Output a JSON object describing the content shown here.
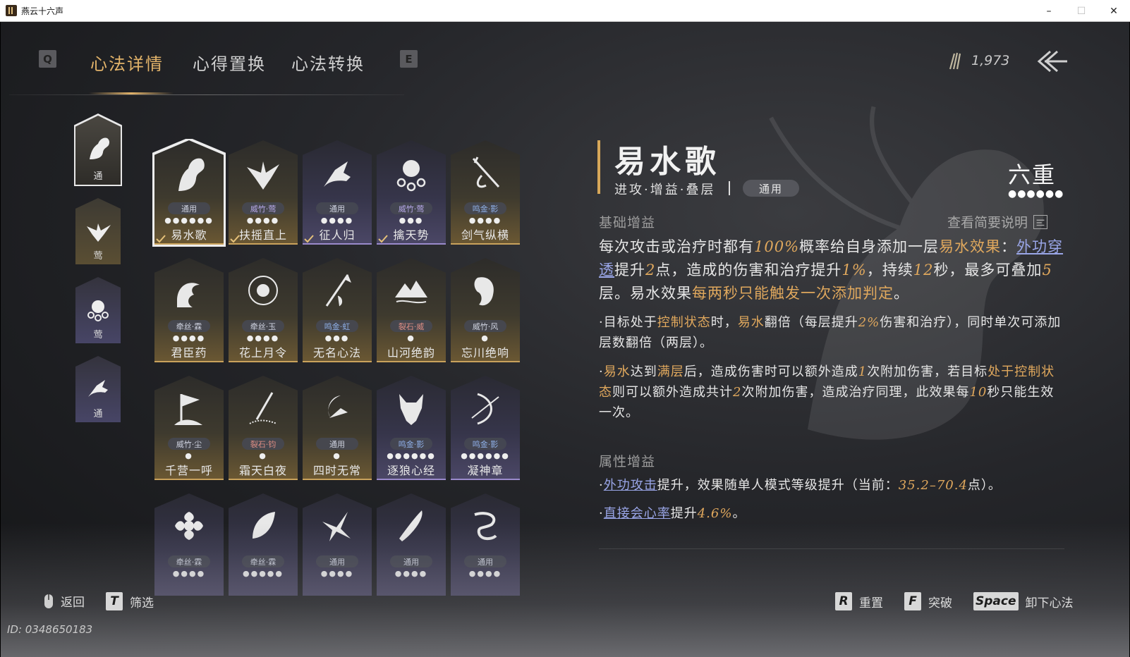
{
  "window": {
    "title": "燕云十六声",
    "min": "–",
    "max": "☐",
    "close": "✕"
  },
  "nav": {
    "key_left": "Q",
    "key_right": "E",
    "tabs": [
      "心法详情",
      "心得置换",
      "心法转换"
    ],
    "active_tab": 0
  },
  "currency": {
    "icon": "feather-icon",
    "amount": "1,973"
  },
  "categories": [
    {
      "label": "通",
      "icon": "horse-icon"
    },
    {
      "label": "莺",
      "icon": "eagle-icon"
    },
    {
      "label": "莺",
      "icon": "chain-fist-icon"
    },
    {
      "label": "通",
      "icon": "bird-hand-icon"
    }
  ],
  "cards": [
    {
      "name": "易水歌",
      "tag": "通用",
      "tag_color": "plain",
      "dots": "●●●●●●",
      "style": "gold",
      "selected": true,
      "check": true,
      "icon": "horse-icon"
    },
    {
      "name": "扶摇直上",
      "tag": "威竹·莺",
      "tag_color": "purple",
      "dots": "●●●●",
      "style": "gold",
      "check": true,
      "icon": "eagle-icon"
    },
    {
      "name": "征人归",
      "tag": "通用",
      "tag_color": "plain",
      "dots": "●●●●",
      "style": "purple",
      "check": true,
      "icon": "bird-hand-icon"
    },
    {
      "name": "擒天势",
      "tag": "威竹·莺",
      "tag_color": "purple",
      "dots": "●●●",
      "style": "purple",
      "check": true,
      "icon": "chain-fist-icon"
    },
    {
      "name": "剑气纵横",
      "tag": "鸣金·影",
      "tag_color": "blue",
      "dots": "●●●●",
      "style": "gold",
      "icon": "sword-icon"
    },
    {
      "name": "君臣药",
      "tag": "牵丝·霖",
      "tag_color": "plain",
      "dots": "●●●●",
      "style": "gold",
      "icon": "wave-icon"
    },
    {
      "name": "花上月令",
      "tag": "牵丝·玉",
      "tag_color": "plain",
      "dots": "●●●●",
      "style": "gold",
      "icon": "flower-moon-icon"
    },
    {
      "name": "无名心法",
      "tag": "鸣金·虹",
      "tag_color": "blue",
      "dots": "●●●",
      "style": "gold",
      "icon": "spear-icon"
    },
    {
      "name": "山河绝韵",
      "tag": "裂石·威",
      "tag_color": "red",
      "dots": "●",
      "style": "gold",
      "icon": "mountain-icon"
    },
    {
      "name": "忘川绝响",
      "tag": "威竹·风",
      "tag_color": "plain",
      "dots": "●",
      "style": "gold",
      "icon": "mask-icon"
    },
    {
      "name": "千营一呼",
      "tag": "威竹·尘",
      "tag_color": "plain",
      "dots": "●",
      "style": "gold",
      "icon": "flag-icon"
    },
    {
      "name": "霜天白夜",
      "tag": "裂石·钧",
      "tag_color": "red",
      "dots": "●",
      "style": "gold",
      "icon": "blade-sand-icon"
    },
    {
      "name": "四时无常",
      "tag": "通用",
      "tag_color": "plain",
      "dots": "●",
      "style": "gold",
      "icon": "moon-bird-icon"
    },
    {
      "name": "逐狼心经",
      "tag": "鸣金·影",
      "tag_color": "blue",
      "dots": "●●●●●●",
      "style": "purple",
      "icon": "wolf-icon"
    },
    {
      "name": "凝神章",
      "tag": "鸣金·影",
      "tag_color": "blue",
      "dots": "●●●●●●",
      "style": "purple",
      "icon": "bow-icon"
    },
    {
      "name": "",
      "tag": "牵丝·霖",
      "tag_color": "plain",
      "dots": "●●●●",
      "style": "purple",
      "icon": "hibiscus-icon"
    },
    {
      "name": "",
      "tag": "牵丝·霖",
      "tag_color": "plain",
      "dots": "●●●●●",
      "style": "purple",
      "icon": "leaf-icon"
    },
    {
      "name": "",
      "tag": "通用",
      "tag_color": "plain",
      "dots": "●●●●",
      "style": "purple",
      "icon": "swallow-icon"
    },
    {
      "name": "",
      "tag": "通用",
      "tag_color": "plain",
      "dots": "●●●●",
      "style": "purple",
      "icon": "broadsword-icon"
    },
    {
      "name": "",
      "tag": "通用",
      "tag_color": "plain",
      "dots": "●●●●",
      "style": "purple",
      "icon": "dragon-icon"
    }
  ],
  "detail": {
    "title": "易水歌",
    "tags": "进攻·增益·叠层",
    "school": "通用",
    "rank": "六重",
    "rank_dots": "●●●●●●",
    "base_header": "基础增益",
    "view_brief": "查看简要说明",
    "base_para": [
      [
        "t",
        "每次攻击或治疗时都有"
      ],
      [
        "n",
        "100%"
      ],
      [
        "t",
        "概率给自身添加一层"
      ],
      [
        "h",
        "易水效果"
      ],
      [
        "t",
        "："
      ],
      [
        "l",
        "外功穿透"
      ],
      [
        "t",
        "提升"
      ],
      [
        "n",
        "2"
      ],
      [
        "t",
        "点，造成的伤害和治疗提升"
      ],
      [
        "n",
        "1%"
      ],
      [
        "t",
        "，持续"
      ],
      [
        "n",
        "12"
      ],
      [
        "t",
        "秒，最多可叠加"
      ],
      [
        "n",
        "5"
      ],
      [
        "t",
        "层。易水效果"
      ],
      [
        "h",
        "每两秒只能触发一次添加判定"
      ],
      [
        "t",
        "。"
      ]
    ],
    "sub_para_1": [
      [
        "t",
        "·目标处于"
      ],
      [
        "h",
        "控制状态"
      ],
      [
        "t",
        "时，"
      ],
      [
        "h",
        "易水"
      ],
      [
        "t",
        "翻倍（每层提升"
      ],
      [
        "n",
        "2%"
      ],
      [
        "t",
        "伤害和治疗），同时单次可添加层数翻倍（两层）。"
      ]
    ],
    "sub_para_2": [
      [
        "t",
        "·"
      ],
      [
        "h",
        "易水"
      ],
      [
        "t",
        "达到"
      ],
      [
        "h",
        "满层"
      ],
      [
        "t",
        "后，造成伤害时可以额外造成"
      ],
      [
        "n",
        "1"
      ],
      [
        "t",
        "次附加伤害，若目标"
      ],
      [
        "h",
        "处于控制状态"
      ],
      [
        "t",
        "则可以额外造成共计"
      ],
      [
        "n",
        "2"
      ],
      [
        "t",
        "次附加伤害，造成治疗同理，此效果每"
      ],
      [
        "n",
        "10"
      ],
      [
        "t",
        "秒只能生效一次。"
      ]
    ],
    "attr_header": "属性增益",
    "attr_1": [
      [
        "t",
        "·"
      ],
      [
        "l",
        "外功攻击"
      ],
      [
        "t",
        "提升，效果随单人模式等级提升（当前："
      ],
      [
        "n",
        "35.2–70.4"
      ],
      [
        "t",
        "点）。"
      ]
    ],
    "attr_2": [
      [
        "t",
        "·"
      ],
      [
        "l",
        "直接会心率"
      ],
      [
        "t",
        "提升"
      ],
      [
        "n",
        "4.6%"
      ],
      [
        "t",
        "。"
      ]
    ]
  },
  "hints": {
    "back": "返回",
    "filter_key": "T",
    "filter": "筛选",
    "reset_key": "R",
    "reset": "重置",
    "break_key": "F",
    "break": "突破",
    "unload_key": "Space",
    "unload": "卸下心法"
  },
  "uid": "ID: 0348650183",
  "colors": {
    "gold": "#e0a85d",
    "link": "#9aa6e8",
    "tab_active": "#e2b36a"
  }
}
